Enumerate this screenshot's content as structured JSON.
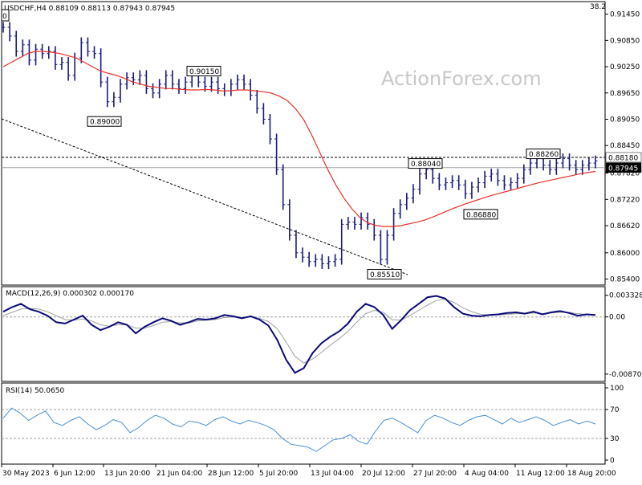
{
  "header": {
    "symbol_line": "USDCHF,H4  0.88109 0.88113 0.87943 0.87945",
    "corner_value": "38.2",
    "watermark": "ActionForex.com",
    "left_marker": "0"
  },
  "colors": {
    "price_bars": "#1a1a7a",
    "moving_average": "#e8302a",
    "macd_line": "#0a0a78",
    "signal_line": "#a0a0a0",
    "rsi_line": "#4a8fd0",
    "level_line": "#000000",
    "current_line": "#a0a0a0"
  },
  "chart_data": [
    {
      "type": "line",
      "panel": "price",
      "yticks": [
        0.9145,
        0.9085,
        0.9025,
        0.8965,
        0.8905,
        0.8845,
        0.8782,
        0.8722,
        0.8662,
        0.86,
        0.854
      ],
      "ytick_labels": [
        "0.91450",
        "0.90850",
        "0.90250",
        "0.89650",
        "0.89050",
        "0.88450",
        "0.87820",
        "0.87220",
        "0.86620",
        "0.86000",
        "0.85400"
      ],
      "ylim": [
        0.853,
        0.917
      ],
      "x_labels": [
        "30 May 2023",
        "6 Jun 12:00",
        "13 Jun 20:00",
        "21 Jun 04:00",
        "28 Jun 12:00",
        "5 Jul 20:00",
        "13 Jul 04:00",
        "20 Jul 12:00",
        "27 Jul 20:00",
        "4 Aug 04:00",
        "11 Aug 12:00",
        "18 Aug 20:00"
      ],
      "annotations": [
        {
          "label": "0.90150",
          "value": 0.9015
        },
        {
          "label": "0.89000",
          "value": 0.89
        },
        {
          "label": "0.88040",
          "value": 0.8804
        },
        {
          "label": "0.88260",
          "value": 0.8826
        },
        {
          "label": "0.86880",
          "value": 0.8688
        },
        {
          "label": "0.85510",
          "value": 0.8551
        }
      ],
      "level": {
        "label": "0.88180",
        "value": 0.8818
      },
      "current": {
        "label": "0.87945",
        "value": 0.87945
      },
      "close_path": [
        0.9115,
        0.9095,
        0.906,
        0.9075,
        0.904,
        0.9065,
        0.9055,
        0.906,
        0.903,
        0.9035,
        0.9005,
        0.9045,
        0.908,
        0.906,
        0.9055,
        0.899,
        0.8945,
        0.8955,
        0.8985,
        0.9,
        0.8995,
        0.9005,
        0.8975,
        0.8965,
        0.8985,
        0.9005,
        0.8985,
        0.8975,
        0.899,
        0.901,
        0.899,
        0.898,
        0.899,
        0.8975,
        0.897,
        0.8985,
        0.8995,
        0.8985,
        0.896,
        0.893,
        0.8905,
        0.886,
        0.879,
        0.871,
        0.864,
        0.86,
        0.859,
        0.858,
        0.8585,
        0.8575,
        0.858,
        0.8585,
        0.8665,
        0.867,
        0.8665,
        0.868,
        0.8665,
        0.864,
        0.8585,
        0.864,
        0.869,
        0.871,
        0.8725,
        0.8745,
        0.878,
        0.879,
        0.877,
        0.8755,
        0.876,
        0.8765,
        0.8755,
        0.8735,
        0.875,
        0.876,
        0.8775,
        0.878,
        0.8765,
        0.8755,
        0.876,
        0.877,
        0.879,
        0.8805,
        0.8815,
        0.88,
        0.879,
        0.8805,
        0.8815,
        0.88,
        0.879,
        0.88,
        0.8805,
        0.881
      ],
      "ma_path": [
        0.9025,
        0.9035,
        0.9045,
        0.9055,
        0.906,
        0.906,
        0.9058,
        0.9055,
        0.905,
        0.9045,
        0.9035,
        0.9025,
        0.9015,
        0.901,
        0.9005,
        0.8998,
        0.899,
        0.8985,
        0.898,
        0.8978,
        0.8975,
        0.8975,
        0.8973,
        0.8972,
        0.8972,
        0.8973,
        0.8972,
        0.897,
        0.897,
        0.8972,
        0.8972,
        0.897,
        0.8968,
        0.8965,
        0.8958,
        0.8948,
        0.893,
        0.8905,
        0.887,
        0.883,
        0.879,
        0.8755,
        0.8725,
        0.87,
        0.868,
        0.8668,
        0.8662,
        0.866,
        0.866,
        0.8662,
        0.8666,
        0.867,
        0.8675,
        0.8682,
        0.869,
        0.8698,
        0.8705,
        0.8712,
        0.8718,
        0.8724,
        0.873,
        0.8735,
        0.874,
        0.8745,
        0.875,
        0.8755,
        0.876,
        0.8764,
        0.8768,
        0.8772,
        0.8776,
        0.878,
        0.8783,
        0.8786
      ]
    },
    {
      "type": "line",
      "panel": "macd",
      "title": "MACD(12,26,9) 0.000302 0.000170",
      "ytick_labels": [
        "0.003328",
        "0.00",
        "-0.008707"
      ],
      "ylim": [
        -0.0092,
        0.004
      ],
      "zero_label": "0.00",
      "series": [
        {
          "values": [
            0.0008,
            0.0015,
            0.002,
            0.0012,
            0.0008,
            0.0002,
            -0.0008,
            -0.001,
            -0.0004,
            0.0002,
            -0.0012,
            -0.002,
            -0.0015,
            -0.0008,
            -0.0012,
            -0.0025,
            -0.0015,
            -0.0008,
            -0.0002,
            -0.0006,
            -0.0012,
            -0.0008,
            -0.0003,
            -0.0004,
            -0.0002,
            0.0003,
            0.0001,
            -0.0002,
            0.0001,
            -0.0004,
            -0.0013,
            -0.0035,
            -0.0065,
            -0.0085,
            -0.0078,
            -0.0055,
            -0.004,
            -0.003,
            -0.0022,
            -0.001,
            0.0008,
            0.002,
            0.0015,
            0.0003,
            -0.0018,
            -0.0005,
            0.001,
            0.002,
            0.003,
            0.0032,
            0.0028,
            0.0015,
            0.0005,
            0.0002,
            0.0001,
            0.0003,
            0.0004,
            0.0006,
            0.0007,
            0.0005,
            0.0008,
            0.0004,
            0.0007,
            0.0009,
            0.0006,
            0.0002,
            0.0004,
            0.0003
          ]
        },
        {
          "values": [
            0.0002,
            0.0007,
            0.0012,
            0.0013,
            0.0012,
            0.0008,
            0.0002,
            -0.0004,
            -0.0005,
            -0.0003,
            -0.0006,
            -0.0012,
            -0.0014,
            -0.0012,
            -0.0012,
            -0.0017,
            -0.0017,
            -0.0013,
            -0.0008,
            -0.0007,
            -0.0009,
            -0.0009,
            -0.0006,
            -0.0005,
            -0.0004,
            -0.0001,
            0.0,
            -0.0001,
            0.0,
            -0.0002,
            -0.0007,
            -0.0018,
            -0.0038,
            -0.006,
            -0.007,
            -0.0064,
            -0.0054,
            -0.0043,
            -0.0033,
            -0.0022,
            -0.0008,
            0.0005,
            0.001,
            0.0007,
            -0.0004,
            -0.0005,
            0.0002,
            0.001,
            0.0018,
            0.0025,
            0.0027,
            0.0022,
            0.0014,
            0.0008,
            0.0004,
            0.0003,
            0.0003,
            0.0004,
            0.0005,
            0.0005,
            0.0006,
            0.0005,
            0.0006,
            0.0007,
            0.0007,
            0.0005,
            0.0004,
            0.0003
          ]
        }
      ]
    },
    {
      "type": "line",
      "panel": "rsi",
      "title": "RSI(14) 50.0650",
      "ytick_labels": [
        "100",
        "70",
        "30",
        "0"
      ],
      "ylim": [
        0,
        100
      ],
      "levels": [
        70,
        30
      ],
      "series": [
        {
          "values": [
            58,
            72,
            65,
            55,
            62,
            68,
            52,
            48,
            55,
            60,
            50,
            42,
            48,
            56,
            52,
            38,
            45,
            55,
            62,
            58,
            50,
            46,
            54,
            52,
            48,
            56,
            60,
            54,
            50,
            55,
            52,
            48,
            42,
            30,
            22,
            20,
            18,
            12,
            20,
            28,
            30,
            35,
            26,
            22,
            40,
            55,
            58,
            52,
            45,
            38,
            55,
            62,
            58,
            52,
            48,
            55,
            60,
            62,
            56,
            50,
            58,
            52,
            56,
            60,
            55,
            48,
            52,
            56,
            50,
            54,
            50
          ]
        }
      ]
    }
  ]
}
